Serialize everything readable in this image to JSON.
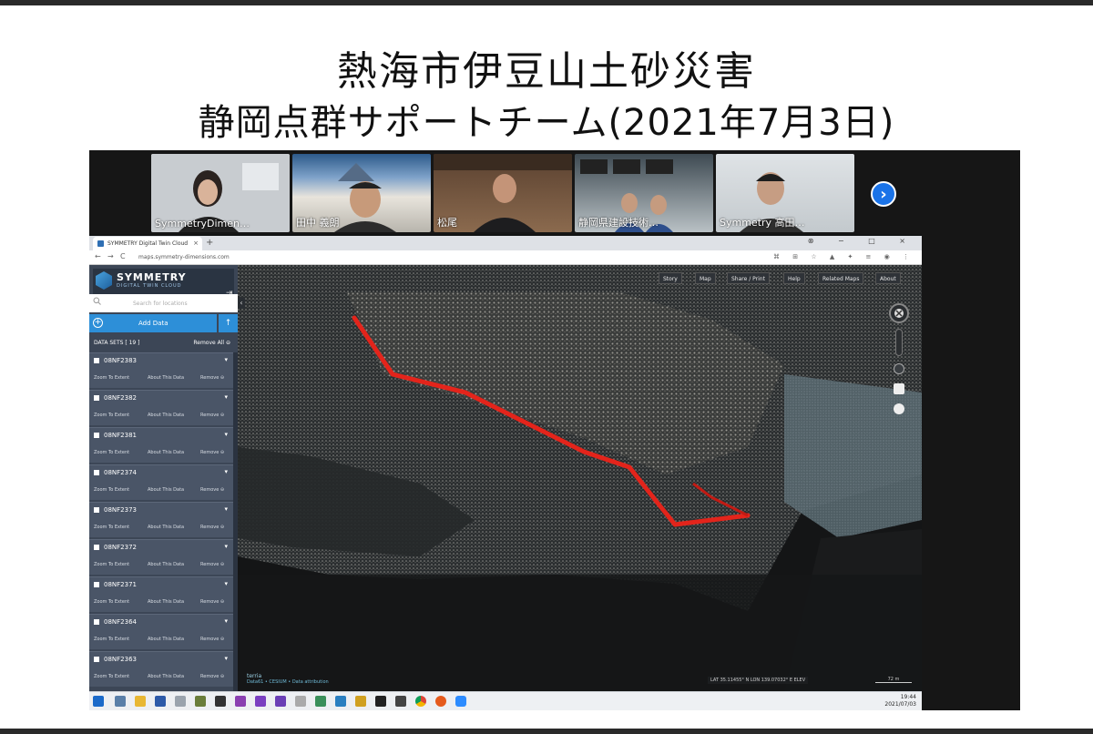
{
  "slide": {
    "title_line1": "熱海市伊豆山土砂災害",
    "title_line2": "静岡点群サポートチーム(2021年7月3日)"
  },
  "video_call": {
    "participants": [
      {
        "name": "SymmetryDimen…"
      },
      {
        "name": "田中 義朗"
      },
      {
        "name": "松尾"
      },
      {
        "name": "静岡県建設技術…"
      },
      {
        "name": "Symmetry 高田…"
      }
    ],
    "next_icon": "›"
  },
  "browser": {
    "tab_title": "SYMMETRY Digital Twin Cloud",
    "tab_close": "×",
    "new_tab": "+",
    "window_controls": "⊗ − □ ×",
    "nav_back": "←",
    "nav_forward": "→",
    "nav_reload": "C",
    "url": "maps.symmetry-dimensions.com",
    "extension_icons": "⌘ ⊞ ☆ ▲ ✦ ≡ ◉ ⋮"
  },
  "sidebar": {
    "logo_text": "SYMMETRY",
    "logo_subtext": "DIGITAL TWIN CLOUD",
    "logout_icon": "⇥",
    "search_placeholder": "Search for locations",
    "add_data_label": "Add Data",
    "upload_icon": "↑",
    "datasets_title": "DATA SETS [ 19 ]",
    "remove_all": "Remove All ⊖",
    "datasets": [
      {
        "name": "08NF2383"
      },
      {
        "name": "08NF2382"
      },
      {
        "name": "08NF2381"
      },
      {
        "name": "08NF2374"
      },
      {
        "name": "08NF2373"
      },
      {
        "name": "08NF2372"
      },
      {
        "name": "08NF2371"
      },
      {
        "name": "08NF2364"
      },
      {
        "name": "08NF2363"
      }
    ],
    "item_actions": {
      "zoom": "Zoom To Extent",
      "about": "About This Data",
      "remove": "Remove ⊖"
    }
  },
  "map": {
    "toolbar": [
      "Story",
      "Map",
      "Share / Print",
      "Help",
      "Related Maps",
      "About"
    ],
    "attribution_logo": "terria",
    "attribution": "Data61 • CESIUM • Data attribution",
    "coordinates": "LAT 35.11455° N    LON 139.07032° E    ELEV",
    "scale": "72 m",
    "collapse_icon": "‹"
  },
  "taskbar": {
    "time": "19:44",
    "date": "2021/07/03"
  }
}
